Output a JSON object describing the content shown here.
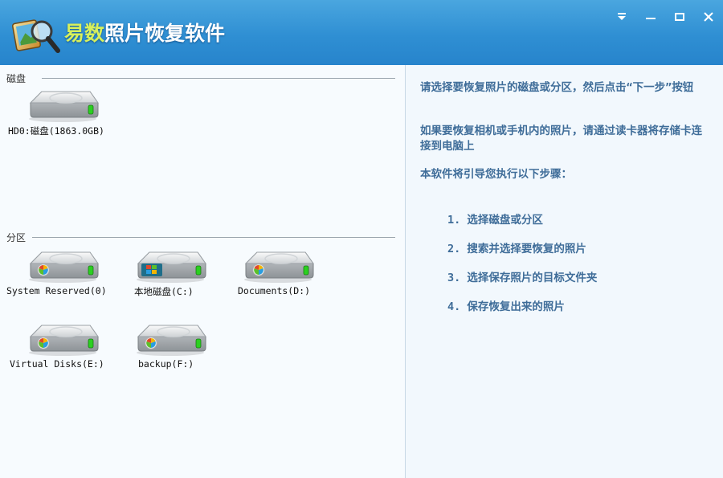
{
  "app": {
    "title_accent": "易数",
    "title_rest": "照片恢复软件",
    "colors": {
      "titlebar": "#2f8fd3",
      "title_accent": "#d7f05c",
      "info_text": "#3f6d99"
    }
  },
  "window_controls": [
    "menu-arrow-icon",
    "minimize-icon",
    "maximize-icon",
    "close-icon"
  ],
  "disks": {
    "label": "磁盘",
    "items": [
      {
        "label": "HD0:磁盘(1863.0GB)",
        "icon": "hard-disk-icon"
      }
    ]
  },
  "partitions": {
    "label": "分区",
    "items": [
      {
        "label": "System Reserved(0)",
        "icon": "partition-drive-icon"
      },
      {
        "label": "本地磁盘(C:)",
        "icon": "windows-system-drive-icon"
      },
      {
        "label": "Documents(D:)",
        "icon": "partition-drive-icon"
      },
      {
        "label": "Virtual Disks(E:)",
        "icon": "partition-drive-icon"
      },
      {
        "label": "backup(F:)",
        "icon": "partition-drive-icon"
      }
    ]
  },
  "info": {
    "para1": "请选择要恢复照片的磁盘或分区，然后点击“下一步”按钮",
    "para2": "如果要恢复相机或手机内的照片，请通过读卡器将存储卡连接到电脑上",
    "para3": "本软件将引导您执行以下步骤：",
    "steps": [
      "1. 选择磁盘或分区",
      "2. 搜索并选择要恢复的照片",
      "3. 选择保存照片的目标文件夹",
      "4. 保存恢复出来的照片"
    ]
  }
}
